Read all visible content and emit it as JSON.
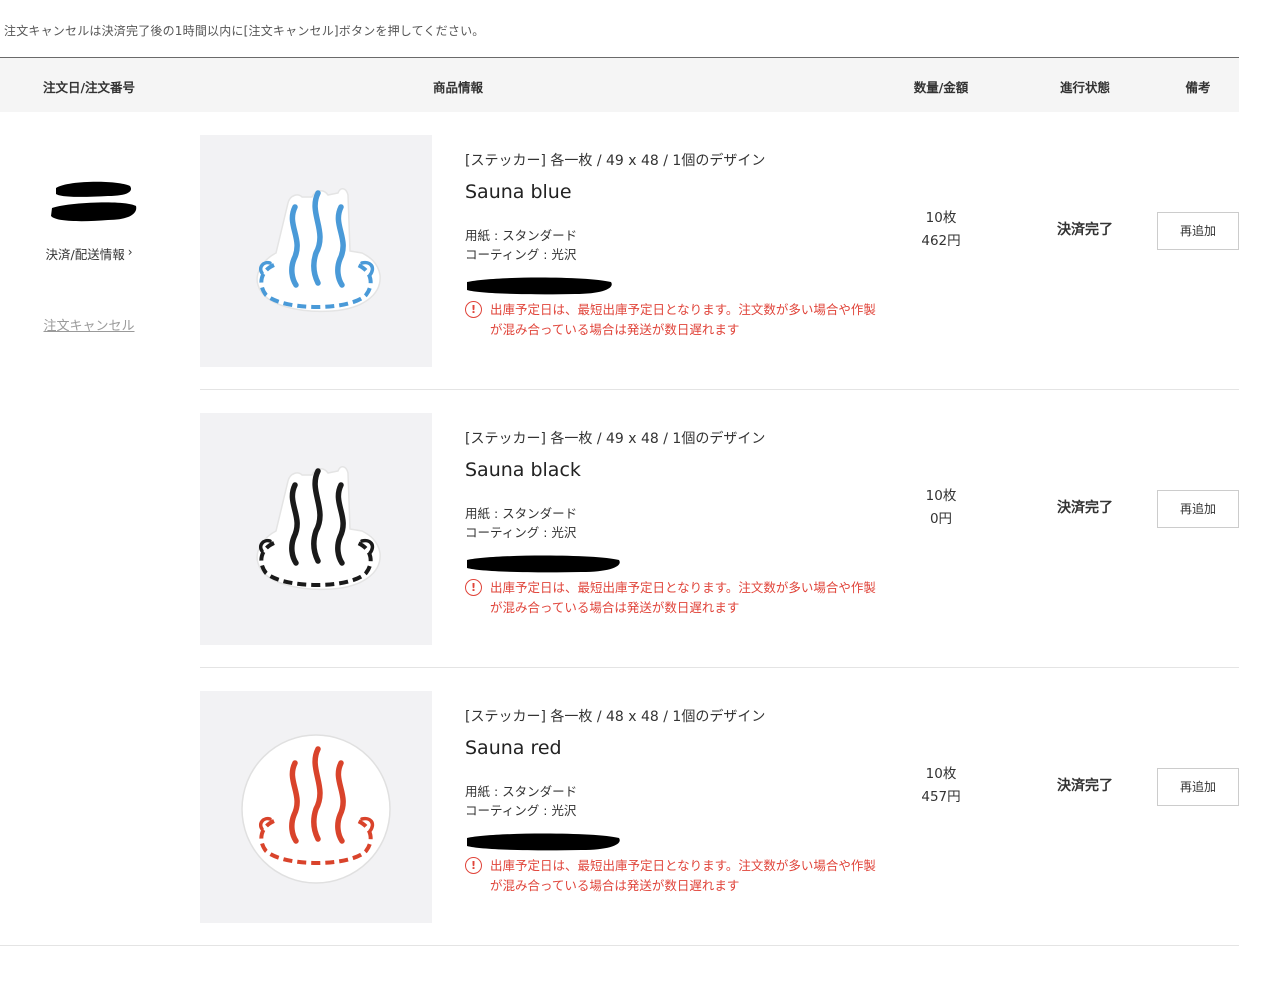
{
  "notice": "注文キャンセルは決済完了後の1時間以内に[注文キャンセル]ボタンを押してください。",
  "table_header": {
    "order": "注文日/注文番号",
    "product": "商品情報",
    "qty_amount": "数量/金額",
    "status": "進行状態",
    "note": "備考"
  },
  "order": {
    "payment_info_label": "決済/配送情報",
    "cancel_label": "注文キャンセル"
  },
  "items": [
    {
      "spec": "[ステッカー] 各一枚 / 49 x 48 / 1個のデザイン",
      "name": "Sauna blue",
      "paper": "用紙 : スタンダード",
      "coating": "コーティング : 光沢",
      "warning": "出庫予定日は、最短出庫予定日となります。注文数が多い場合や作製が混み合っている場合は発送が数日遅れます",
      "qty": "10枚",
      "price": "462円",
      "status": "決済完了",
      "readd_label": "再追加",
      "icon_color": "#4a9ad8",
      "icon_shape": "die-cut"
    },
    {
      "spec": "[ステッカー] 各一枚 / 49 x 48 / 1個のデザイン",
      "name": "Sauna black",
      "paper": "用紙 : スタンダード",
      "coating": "コーティング : 光沢",
      "warning": "出庫予定日は、最短出庫予定日となります。注文数が多い場合や作製が混み合っている場合は発送が数日遅れます",
      "qty": "10枚",
      "price": "0円",
      "status": "決済完了",
      "readd_label": "再追加",
      "icon_color": "#1a1a1a",
      "icon_shape": "die-cut"
    },
    {
      "spec": "[ステッカー] 各一枚 / 48 x 48 / 1個のデザイン",
      "name": "Sauna red",
      "paper": "用紙 : スタンダード",
      "coating": "コーティング : 光沢",
      "warning": "出庫予定日は、最短出庫予定日となります。注文数が多い場合や作製が混み合っている場合は発送が数日遅れます",
      "qty": "10枚",
      "price": "457円",
      "status": "決済完了",
      "readd_label": "再追加",
      "icon_color": "#d9432b",
      "icon_shape": "circle"
    }
  ]
}
